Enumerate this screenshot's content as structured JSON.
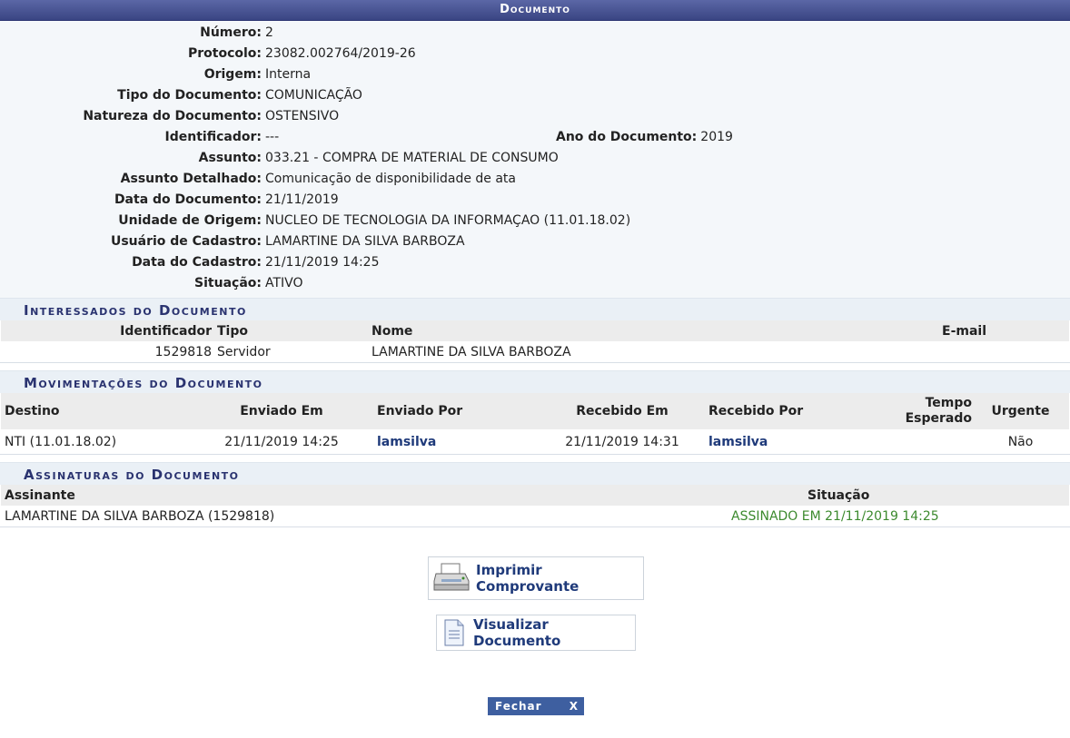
{
  "header": {
    "title": "Documento"
  },
  "details": [
    {
      "label": "Número:",
      "value": "2"
    },
    {
      "label": "Protocolo:",
      "value": "23082.002764/2019-26"
    },
    {
      "label": "Origem:",
      "value": "Interna"
    },
    {
      "label": "Tipo do Documento:",
      "value": "COMUNICAÇÃO"
    },
    {
      "label": "Natureza do Documento:",
      "value": "OSTENSIVO"
    },
    {
      "label": "Identificador:",
      "value": "---"
    },
    {
      "label": "Assunto:",
      "value": "033.21 - COMPRA DE MATERIAL DE CONSUMO"
    },
    {
      "label": "Assunto Detalhado:",
      "value": "Comunicação de disponibilidade de ata"
    },
    {
      "label": "Data do Documento:",
      "value": "21/11/2019"
    },
    {
      "label": "Unidade de Origem:",
      "value": "NUCLEO DE TECNOLOGIA DA INFORMAÇAO (11.01.18.02)"
    },
    {
      "label": "Usuário de Cadastro:",
      "value": "LAMARTINE DA SILVA BARBOZA"
    },
    {
      "label": "Data do Cadastro:",
      "value": "21/11/2019 14:25"
    },
    {
      "label": "Situação:",
      "value": "ATIVO"
    }
  ],
  "ano": {
    "label": "Ano do Documento:",
    "value": "2019"
  },
  "interessados": {
    "title": "Interessados do Documento",
    "headers": [
      "Identificador",
      "Tipo",
      "Nome",
      "E-mail"
    ],
    "rows": [
      [
        "1529818",
        "Servidor",
        "LAMARTINE DA SILVA BARBOZA",
        ""
      ]
    ]
  },
  "movimentacoes": {
    "title": "Movimentações do Documento",
    "headers": [
      "Destino",
      "Enviado Em",
      "Enviado Por",
      "Recebido Em",
      "Recebido Por",
      "Tempo Esperado",
      "Urgente"
    ],
    "rows": [
      [
        "NTI (11.01.18.02)",
        "21/11/2019 14:25",
        "lamsilva",
        "21/11/2019 14:31",
        "lamsilva",
        "",
        "Não"
      ]
    ]
  },
  "assinaturas": {
    "title": "Assinaturas do Documento",
    "headers": [
      "Assinante",
      "Situação"
    ],
    "rows": [
      [
        "LAMARTINE DA SILVA BARBOZA (1529818)",
        "ASSINADO EM 21/11/2019 14:25"
      ]
    ]
  },
  "actions": {
    "print_label": "Imprimir Comprovante",
    "view_label": "Visualizar Documento"
  },
  "close": {
    "label": "Fechar",
    "icon": "X"
  }
}
